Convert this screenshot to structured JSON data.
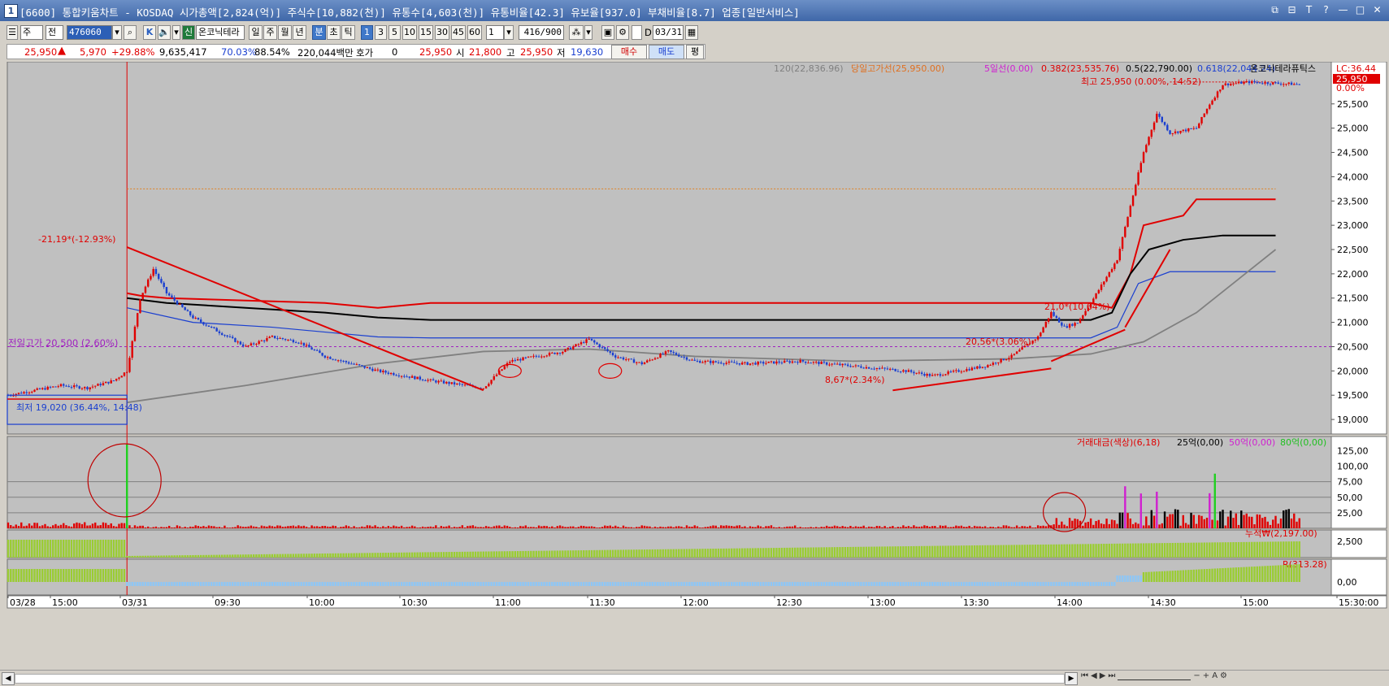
{
  "window": {
    "number": "1",
    "title": "[6600] 통합키움차트 - KOSDAQ 시가총액[2,824(억)] 주식수[10,882(천)] 유통수[4,603(천)] 유통비율[42.3] 유보율[937.0] 부채비율[8.7] 업종[일반서비스]",
    "controls": [
      "⧉",
      "⊟",
      "T",
      "?",
      "—",
      "□",
      "✕"
    ]
  },
  "toolbar": {
    "period_select": "주",
    "price_select": "전",
    "code_input": "476060",
    "search_icon": "⌕",
    "k_btn": "K",
    "new_badge": "신",
    "stock_name": "온코닉테라",
    "period_buttons": [
      "일",
      "주",
      "월",
      "년",
      "분",
      "초",
      "틱"
    ],
    "selected_period": "분",
    "interval_buttons": [
      "1",
      "3",
      "5",
      "10",
      "15",
      "30",
      "45",
      "60"
    ],
    "selected_interval": "1",
    "interval_input": "1",
    "count": "416",
    "count_total": "/900",
    "date_prefix": "D",
    "date": "03/31"
  },
  "quote": {
    "price": "25,950",
    "change": "5,970",
    "change_pct": "+29.88%",
    "volume": "9,635,417",
    "ratio1": "70.03%",
    "ratio2": "88.54%",
    "amount": "220,044백만",
    "hoga_label": "호가",
    "hoga_value": "0",
    "hoga_price": "25,950",
    "open_label": "시",
    "open": "21,800",
    "high_label": "고",
    "high": "25,950",
    "low_label": "저",
    "low": "19,630",
    "buy_label": "매수",
    "sell_label": "매도",
    "eval_label": "평"
  },
  "legend": {
    "ma120": "120(22,836.96)",
    "high_line": "당일고가선(25,950.00)",
    "ma5d": "5일선(0.00)",
    "fib382": "0.382(23,535.76)",
    "fib5": "0.5(22,790.00)",
    "fib618": "0.618(22,044.24)",
    "stock": "온코닉테라퓨틱스",
    "lc": "LC:36.44",
    "current": "25,950",
    "pct": "0.00%"
  },
  "annotations": {
    "high_label": "최고 25,950 (0.00%, 14:52)",
    "left_high": "-21,19*(-12.93%)",
    "prev_high": "전일고가 20,500 (2.60%)",
    "low_label": "최저 19,020 (36.44%, 14:48)",
    "ann1": "20,56*(3.06%)",
    "ann2": "8,67*(2.34%)",
    "ann3": "21,0*(10.64%)"
  },
  "volume_legend": {
    "title": "거래대금(색상)(6,18)",
    "s25": "25억(0,00)",
    "s50": "50억(0,00)",
    "s80": "80억(0,00)"
  },
  "cum_legend": "누적₩(2,197.00)",
  "r_legend": "R(313.28)",
  "price_axis": [
    "25,500",
    "25,000",
    "24,500",
    "24,000",
    "23,500",
    "23,000",
    "22,500",
    "22,000",
    "21,500",
    "21,000",
    "20,500",
    "20,000",
    "19,500",
    "19,000"
  ],
  "vol_axis": [
    "125,00",
    "100,00",
    "75,00",
    "50,00",
    "25,00"
  ],
  "cum_axis": "2,500",
  "r_axis": "0,00",
  "time_axis": [
    "03/28",
    "15:00",
    "03/31",
    "09:30",
    "10:00",
    "10:30",
    "11:00",
    "11:30",
    "12:00",
    "12:30",
    "13:00",
    "13:30",
    "14:00",
    "14:30",
    "15:00",
    "15:30:00"
  ],
  "colors": {
    "up": "#e00000",
    "down": "#1a3fd0",
    "panel": "#c0c0c0",
    "ma": "#808080"
  },
  "chart_data": {
    "type": "candlestick",
    "ylim": [
      18700,
      26200
    ],
    "price_path": [
      [
        0,
        19500
      ],
      [
        10,
        19600
      ],
      [
        20,
        19700
      ],
      [
        30,
        19650
      ],
      [
        40,
        19800
      ],
      [
        45,
        20000
      ],
      [
        50,
        21500
      ],
      [
        55,
        22100
      ],
      [
        60,
        21600
      ],
      [
        70,
        21100
      ],
      [
        80,
        20800
      ],
      [
        90,
        20500
      ],
      [
        100,
        20700
      ],
      [
        110,
        20600
      ],
      [
        120,
        20300
      ],
      [
        140,
        20000
      ],
      [
        160,
        19800
      ],
      [
        180,
        19650
      ],
      [
        190,
        20200
      ],
      [
        200,
        20300
      ],
      [
        210,
        20400
      ],
      [
        220,
        20650
      ],
      [
        230,
        20300
      ],
      [
        240,
        20150
      ],
      [
        250,
        20400
      ],
      [
        260,
        20200
      ],
      [
        280,
        20150
      ],
      [
        300,
        20200
      ],
      [
        320,
        20100
      ],
      [
        340,
        20000
      ],
      [
        350,
        19900
      ],
      [
        360,
        20000
      ],
      [
        370,
        20100
      ],
      [
        380,
        20300
      ],
      [
        390,
        20700
      ],
      [
        395,
        21200
      ],
      [
        400,
        20900
      ],
      [
        405,
        21000
      ],
      [
        410,
        21400
      ],
      [
        420,
        22300
      ],
      [
        430,
        24500
      ],
      [
        435,
        25300
      ],
      [
        440,
        24900
      ],
      [
        450,
        25000
      ],
      [
        455,
        25500
      ],
      [
        460,
        25900
      ],
      [
        470,
        25950
      ],
      [
        490,
        25900
      ]
    ],
    "resistance_upper": 21400,
    "resistance_mid": 21050,
    "resistance_lower": 20680,
    "prev_high": 20500,
    "day_high": 25950,
    "fib382": 23535.76,
    "fib5": 22790,
    "fib618": 22044.24
  }
}
